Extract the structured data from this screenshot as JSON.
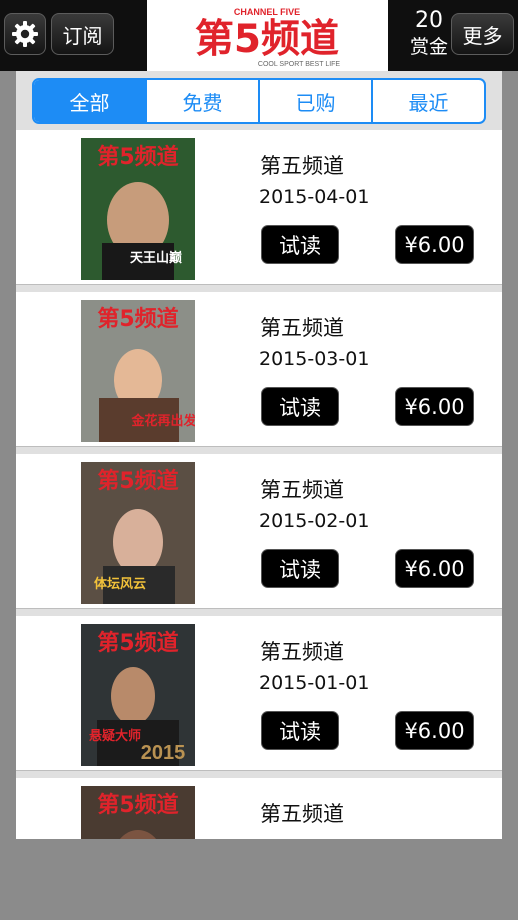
{
  "topbar": {
    "gear_icon": "gear-icon",
    "subscribe_label": "订阅",
    "logo_text": "第5频道",
    "logo_small_top": "CHANNEL FIVE",
    "logo_small_bottom": "COOL SPORT BEST LIFE",
    "reward_count": "20",
    "reward_label": "赏金",
    "more_label": "更多"
  },
  "tabs": [
    {
      "label": "全部",
      "active": true
    },
    {
      "label": "免费",
      "active": false
    },
    {
      "label": "已购",
      "active": false
    },
    {
      "label": "最近",
      "active": false
    }
  ],
  "issues": [
    {
      "title": "第五频道",
      "date": "2015-04-01",
      "trial_label": "试读",
      "price": "¥6.00",
      "cover_caption": "天王山巅",
      "cover_bg": "#2d5a2f"
    },
    {
      "title": "第五频道",
      "date": "2015-03-01",
      "trial_label": "试读",
      "price": "¥6.00",
      "cover_caption": "金花再出发",
      "cover_bg": "#8c8f88"
    },
    {
      "title": "第五频道",
      "date": "2015-02-01",
      "trial_label": "试读",
      "price": "¥6.00",
      "cover_caption": "体坛风云",
      "cover_bg": "#5b4f44"
    },
    {
      "title": "第五频道",
      "date": "2015-01-01",
      "trial_label": "试读",
      "price": "¥6.00",
      "cover_caption": "悬疑大师",
      "cover_bg": "#2f3436"
    },
    {
      "title": "第五频道",
      "date": "",
      "trial_label": "",
      "price": "",
      "cover_caption": "",
      "cover_bg": "#4a3b31"
    }
  ],
  "colors": {
    "accent": "#1d8cf5",
    "logo_red": "#e0232b",
    "topbar_bg": "#0f0f0f"
  }
}
